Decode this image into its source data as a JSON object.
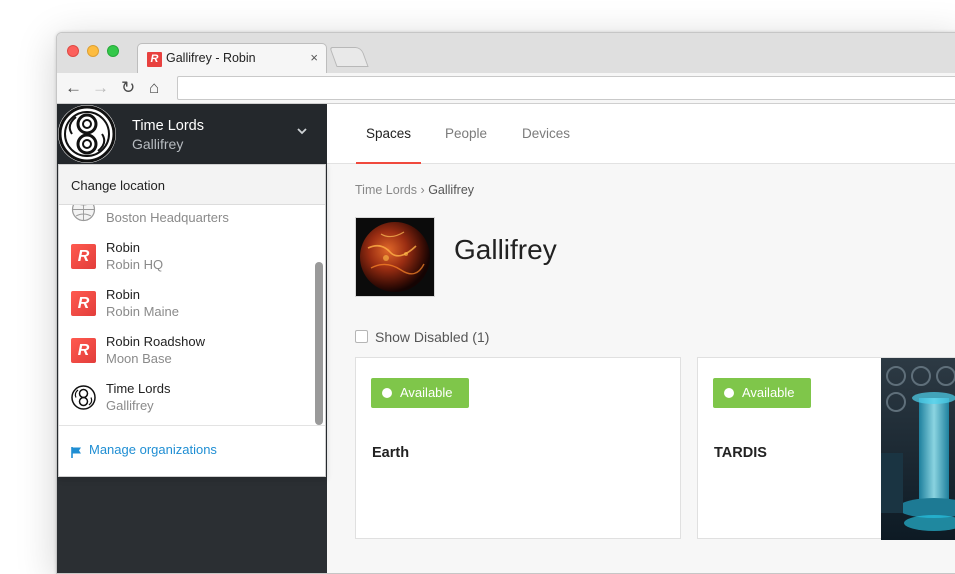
{
  "browser": {
    "tab_title": "Gallifrey - Robin",
    "tab_favicon_letter": "R",
    "tab_close": "×",
    "url": "",
    "nav": {
      "back": "←",
      "forward": "→",
      "reload": "↻",
      "home": "⌂"
    }
  },
  "org_header": {
    "name": "Time Lords",
    "location": "Gallifrey",
    "chevron": "⌄"
  },
  "dropdown": {
    "header": "Change location",
    "items": [
      {
        "name": "",
        "location": "Boston Headquarters",
        "icon": "globe-icon"
      },
      {
        "name": "Robin",
        "location": "Robin HQ",
        "icon": "robin-logo-icon"
      },
      {
        "name": "Robin",
        "location": "Robin Maine",
        "icon": "robin-logo-icon"
      },
      {
        "name": "Robin Roadshow",
        "location": "Moon Base",
        "icon": "robin-logo-icon"
      },
      {
        "name": "Time Lords",
        "location": "Gallifrey",
        "icon": "seal-of-rassilon-icon"
      }
    ],
    "robin_letter": "R",
    "footer": "Manage organizations"
  },
  "topnav": {
    "tabs": [
      "Spaces",
      "People",
      "Devices"
    ],
    "active": "Spaces"
  },
  "breadcrumb": {
    "parent": "Time Lords",
    "separator": "›",
    "current": "Gallifrey"
  },
  "space": {
    "title": "Gallifrey",
    "show_disabled_label": "Show Disabled (1)"
  },
  "cards": [
    {
      "status": "Available",
      "title": "Earth"
    },
    {
      "status": "Available",
      "title": "TARDIS"
    }
  ],
  "colors": {
    "accent": "#f0493d",
    "available": "#7fc64a",
    "sidebar": "#2b2f33",
    "link": "#1f8ed3"
  }
}
